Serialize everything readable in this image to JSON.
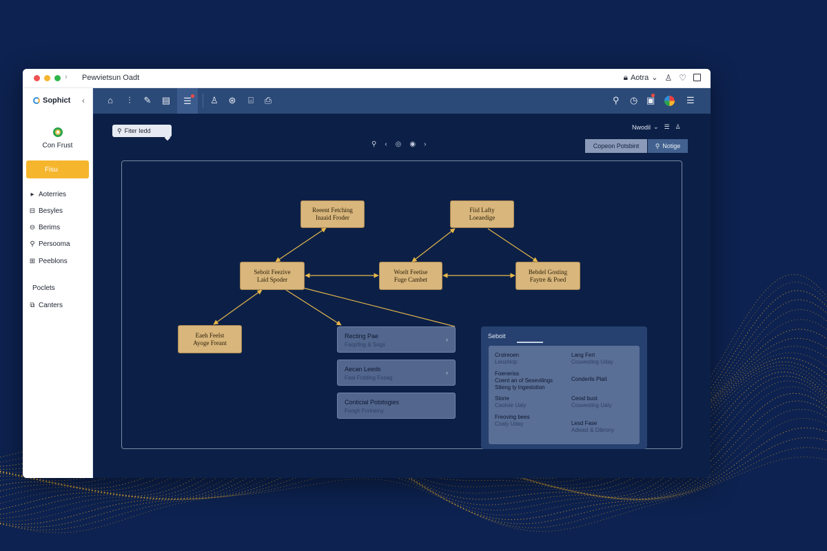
{
  "window": {
    "title": "Pewvietsun Oadt",
    "user": "Aotra"
  },
  "sidebar": {
    "brand": "Sophict",
    "profile_label": "Con Frust",
    "active_item": "Fisu",
    "items": [
      {
        "label": "Aoterries",
        "icon": "chevron-right"
      },
      {
        "label": "Besyles",
        "icon": "box"
      },
      {
        "label": "Berims",
        "icon": "eye"
      },
      {
        "label": "Persooma",
        "icon": "search"
      },
      {
        "label": "Peeblons",
        "icon": "grid"
      }
    ],
    "section": "Poclets",
    "section_items": [
      {
        "label": "Canters",
        "icon": "layers"
      }
    ]
  },
  "toolbar": {
    "left_icons": [
      "home-icon",
      "audio-icon",
      "pen-icon",
      "document-icon",
      "list-icon",
      "user-icon",
      "globe-icon",
      "bank-icon",
      "clipboard-icon"
    ],
    "right_icons": [
      "search-icon",
      "clock-icon",
      "notification-icon",
      "avatar",
      "menu-icon"
    ]
  },
  "canvas_header": {
    "filter_label": "Fiter Iedd",
    "model_label": "Nwodil",
    "primary_button": "Copeon Potsbint",
    "secondary_button": "Notige"
  },
  "diagram": {
    "nodes": [
      {
        "id": "n1",
        "line1": "Reeent Fetching",
        "line2": "Inaaid Froder"
      },
      {
        "id": "n2",
        "line1": "Fiid Lafty",
        "line2": "Loeaedige"
      },
      {
        "id": "n3",
        "line1": "Seboit Feezive",
        "line2": "Laid Spoder"
      },
      {
        "id": "n4",
        "line1": "Woelt Feetise",
        "line2": "Fuge Cambet"
      },
      {
        "id": "n5",
        "line1": "Bebdel Gosting",
        "line2": "Faytre & Poed"
      },
      {
        "id": "n6",
        "line1": "Eaeh Feelst",
        "line2": "Ayoge Freant"
      }
    ],
    "cards": [
      {
        "title": "Recting Pae",
        "sub": "Faopfing & Sogs"
      },
      {
        "title": "Aecan Leeds",
        "sub": "Faai Frdding Fosag"
      },
      {
        "title": "Conticial Pobitogies",
        "sub": "Foogh Fcrinsiny"
      }
    ]
  },
  "side_panel": {
    "title": "Seboit",
    "fields": [
      {
        "label": "Croireoen",
        "value": "Leoshlop"
      },
      {
        "label": "Lang Fert",
        "value": "Couvesting Uday"
      },
      {
        "label": "Foeneriss",
        "value": "Coent an of Sesevilings Stteng ty lngestotion"
      },
      {
        "label": "Conderils Plait",
        "value": ""
      },
      {
        "label": "Stone",
        "value": "Caoloie Ualy"
      },
      {
        "label": "Ceosl bust",
        "value": "Couvesting Uaty"
      },
      {
        "label": "Freoving bees",
        "value": "Coaly Uday"
      },
      {
        "label": "Lesd Fase",
        "value": "Adeast & Dibrony"
      }
    ]
  },
  "colors": {
    "background": "#0d2250",
    "accent": "#f5b52c",
    "toolbar": "#2c4a78",
    "node": "#d8b67c",
    "edge": "#e8b84a"
  }
}
